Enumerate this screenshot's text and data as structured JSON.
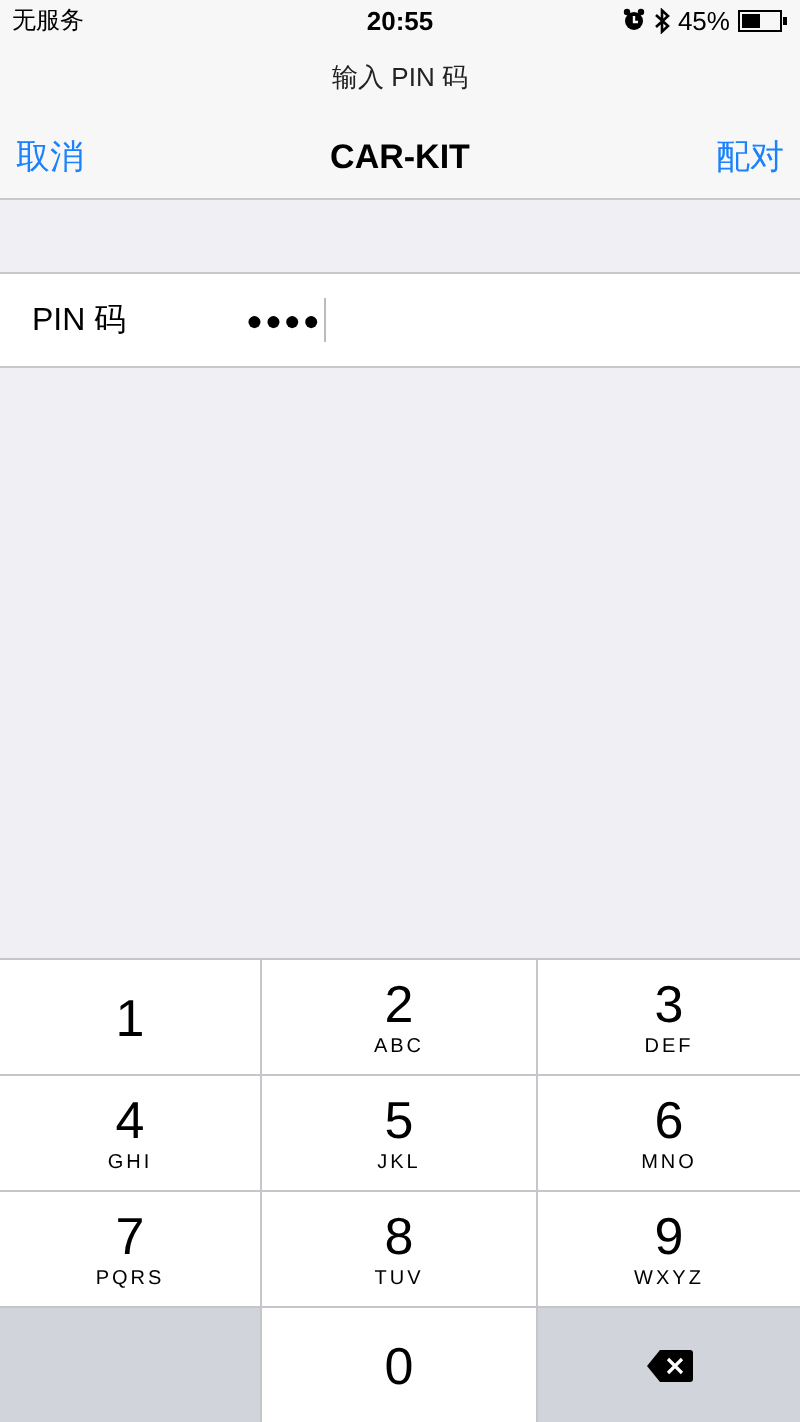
{
  "status_bar": {
    "carrier": "无服务",
    "time": "20:55",
    "battery": "45%"
  },
  "prompt": "输入 PIN 码",
  "nav": {
    "left": "取消",
    "title": "CAR-KIT",
    "right": "配对"
  },
  "pin_field": {
    "label": "PIN 码",
    "value": "●●●●"
  },
  "keypad": [
    {
      "kind": "digit",
      "digit": "1"
    },
    {
      "kind": "digit",
      "digit": "2",
      "letters": "ABC"
    },
    {
      "kind": "digit",
      "digit": "3",
      "letters": "DEF"
    },
    {
      "kind": "digit",
      "digit": "4",
      "letters": "GHI"
    },
    {
      "kind": "digit",
      "digit": "5",
      "letters": "JKL"
    },
    {
      "kind": "digit",
      "digit": "6",
      "letters": "MNO"
    },
    {
      "kind": "digit",
      "digit": "7",
      "letters": "PQRS"
    },
    {
      "kind": "digit",
      "digit": "8",
      "letters": "TUV"
    },
    {
      "kind": "digit",
      "digit": "9",
      "letters": "WXYZ"
    },
    {
      "kind": "blank"
    },
    {
      "kind": "digit",
      "digit": "0"
    },
    {
      "kind": "delete"
    }
  ]
}
